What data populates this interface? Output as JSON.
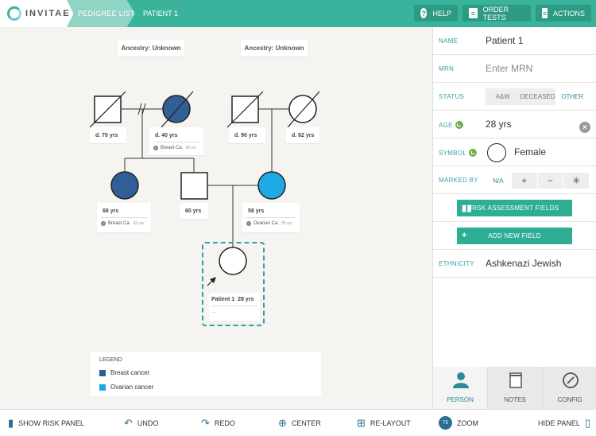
{
  "header": {
    "logo_text": "INVITAE",
    "breadcrumbs": [
      {
        "label": "PEDIGREE LIST"
      },
      {
        "label": "PATIENT 1"
      }
    ],
    "buttons": {
      "help": "HELP",
      "order_tests": "ORDER TESTS",
      "actions": "ACTIONS"
    }
  },
  "pedigree": {
    "ancestry_left": "Ancestry: Unknown",
    "ancestry_right": "Ancestry: Unknown",
    "relatives": [
      {
        "age": "d. 70 yrs"
      },
      {
        "age": "d. 40 yrs",
        "condition": "Breast Ca.",
        "condition_age": "38 yrs"
      },
      {
        "age": "d. 90 yrs"
      },
      {
        "age": "d. 82 yrs"
      },
      {
        "age": "68 yrs",
        "condition": "Breast Ca.",
        "condition_age": "42 yrs"
      },
      {
        "age": "60 yrs"
      },
      {
        "age": "58 yrs",
        "condition": "Ovarian Ca.",
        "condition_age": "35 yrs"
      }
    ],
    "patient": {
      "name": "Patient 1",
      "age": "28 yrs",
      "more": "..."
    },
    "colors": {
      "breast_cancer": "#2f5f96",
      "ovarian_cancer": "#1fa9e6",
      "selection": "#2e9fa8"
    }
  },
  "legend": {
    "title": "LEGEND",
    "items": [
      {
        "label": "Breast cancer",
        "color": "#2f5f96"
      },
      {
        "label": "Ovarian cancer",
        "color": "#1fa9e6"
      }
    ]
  },
  "panel": {
    "name_label": "NAME",
    "name_value": "Patient 1",
    "mrn_label": "MRN",
    "mrn_placeholder": "Enter MRN",
    "status_label": "STATUS",
    "status_options": [
      "A&W",
      "DECEASED",
      "OTHER"
    ],
    "status_selected": "OTHER",
    "age_label": "AGE",
    "age_value": "28 yrs",
    "symbol_label": "SYMBOL",
    "symbol_value": "Female",
    "marked_by_label": "MARKED BY",
    "marked_by_options": [
      "N/A",
      "+",
      "−",
      "✳"
    ],
    "risk_button": "RISK ASSESSMENT FIELDS",
    "add_field_button": "ADD NEW FIELD",
    "ethnicity_label": "ETHNICITY",
    "ethnicity_value": "Ashkenazi Jewish",
    "tabs": [
      {
        "label": "PERSON",
        "icon": "person-icon"
      },
      {
        "label": "NOTES",
        "icon": "notes-icon"
      },
      {
        "label": "CONFIG",
        "icon": "compass-icon"
      }
    ]
  },
  "footer": {
    "show_risk_panel": "SHOW RISK PANEL",
    "undo": "UNDO",
    "redo": "REDO",
    "center": "CENTER",
    "relayout": "RE-LAYOUT",
    "zoom_value": "75",
    "zoom": "ZOOM",
    "hide_panel": "HIDE PANEL"
  }
}
